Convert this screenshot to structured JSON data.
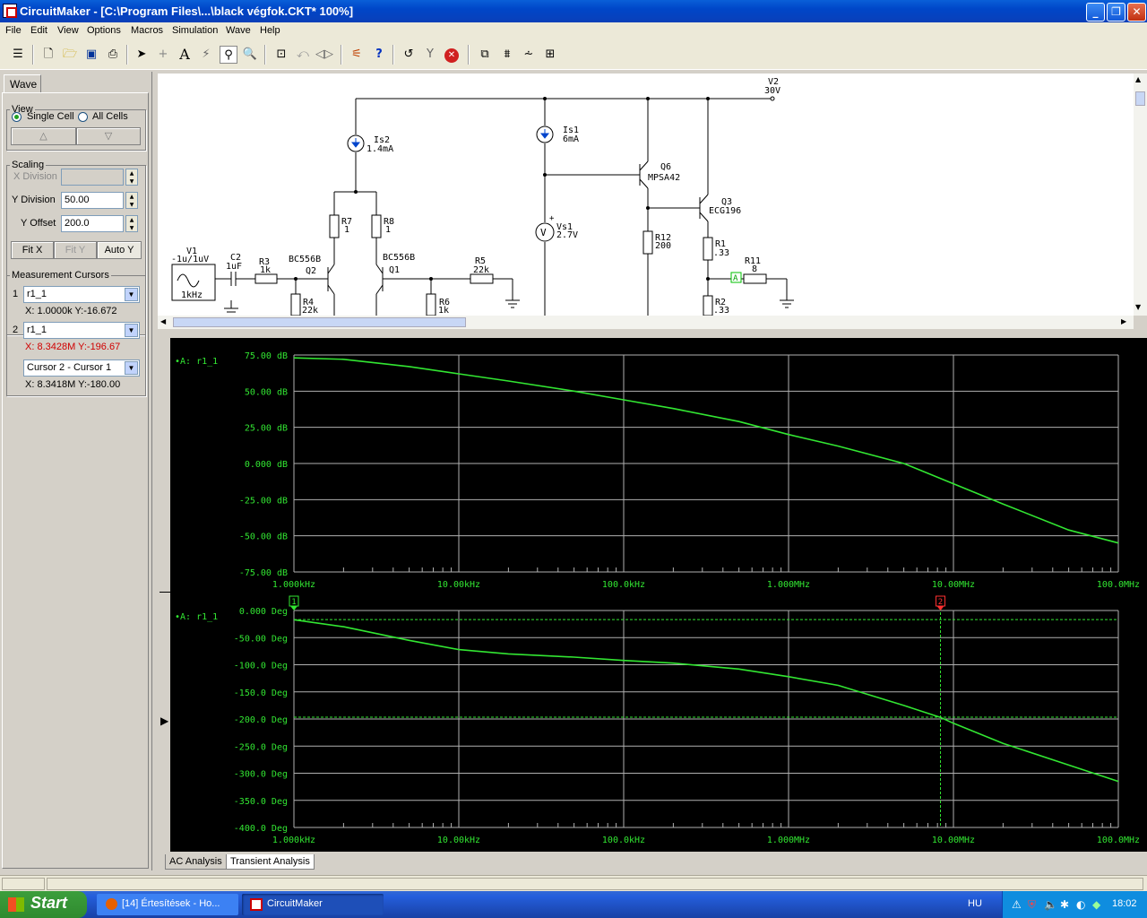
{
  "window": {
    "title": "CircuitMaker - [C:\\Program Files\\...\\black végfok.CKT* 100%]"
  },
  "menu": [
    "File",
    "Edit",
    "View",
    "Options",
    "Macros",
    "Simulation",
    "Wave",
    "Help"
  ],
  "panel": {
    "tab": "Wave",
    "view_label": "View",
    "single_cell": "Single Cell",
    "all_cells": "All Cells",
    "up_arrow": "△",
    "down_arrow": "▽",
    "scaling_label": "Scaling",
    "x_division_label": "X Division",
    "x_division_value": "",
    "y_division_label": "Y Division",
    "y_division_value": "50.00",
    "y_offset_label": "Y Offset",
    "y_offset_value": "200.0",
    "fit_x": "Fit X",
    "fit_y": "Fit Y",
    "auto_y": "Auto Y",
    "cursors_label": "Measurement Cursors",
    "cursor1_num": "1",
    "cursor1_select": "r1_1",
    "cursor1_readout": "X: 1.0000k  Y:-16.672",
    "cursor2_num": "2",
    "cursor2_select": "r1_1",
    "cursor2_readout": "X: 8.3428M  Y:-196.67",
    "diff_select": "Cursor 2 - Cursor 1",
    "diff_readout": "X: 8.3418M  Y:-180.00"
  },
  "schematic": {
    "labels": {
      "v2": "V2",
      "v2val": "30V",
      "is2": "Is2",
      "is2val": "1.4mA",
      "is1": "Is1",
      "is1val": "6mA",
      "q6": "Q6",
      "q6val": "MPSA42",
      "q3": "Q3",
      "q3val": "ECG196",
      "r7": "R7",
      "r7val": "1",
      "r8": "R8",
      "r8val": "1",
      "vs1": "Vs1",
      "vs1val": "2.7V",
      "r12": "R12",
      "r12val": "200",
      "r1": "R1",
      "r1val": ".33",
      "v1": "V1",
      "v1val": "-1u/1uV",
      "v1freq": "1kHz",
      "c2": "C2",
      "c2val": "1uF",
      "r3": "R3",
      "r3val": "1k",
      "q2type": "BC556B",
      "q2": "Q2",
      "q1type": "BC556B",
      "q1": "Q1",
      "r5": "R5",
      "r5val": "22k",
      "r11": "R11",
      "r11val": "8",
      "probe": "A",
      "r4": "R4",
      "r4val": "22k",
      "r6": "R6",
      "r6val": "1k",
      "r2": "R2",
      "r2val": ".33"
    }
  },
  "wave_tabs": [
    "AC Analysis",
    "Transient Analysis"
  ],
  "taskbar": {
    "start": "Start",
    "tasks": [
      "[14] Értesítések - Ho...",
      "CircuitMaker"
    ],
    "lang": "HU",
    "clock": "18:02"
  },
  "colors": {
    "trace": "#32e632",
    "grid": "#b0b0b0",
    "cursor2": "#ff3030",
    "axis_text": "#32e632"
  },
  "chart_data": [
    {
      "type": "line",
      "title": "",
      "series": [
        {
          "name": "A: r1_1",
          "x": [
            1000,
            2000,
            5000,
            10000,
            20000,
            50000,
            100000,
            200000,
            500000,
            1000000,
            2000000,
            5000000,
            10000000,
            20000000,
            50000000,
            100000000
          ],
          "y": [
            73,
            72,
            67,
            62,
            57,
            50,
            44,
            38,
            29,
            20,
            12,
            0,
            -14,
            -28,
            -46,
            -55
          ]
        }
      ],
      "xscale": "log",
      "xlim": [
        1000,
        100000000
      ],
      "ylim": [
        -75,
        75
      ],
      "xticks": [
        "1.000kHz",
        "10.00kHz",
        "100.0kHz",
        "1.000MHz",
        "10.00MHz",
        "100.0MHz"
      ],
      "yticks": [
        "75.00 dB",
        "50.00 dB",
        "25.00 dB",
        "0.000 dB",
        "-25.00 dB",
        "-50.00 dB",
        "-75.00 dB"
      ],
      "grid": true
    },
    {
      "type": "line",
      "title": "",
      "series": [
        {
          "name": "A: r1_1",
          "x": [
            1000,
            2000,
            5000,
            10000,
            20000,
            50000,
            100000,
            200000,
            500000,
            1000000,
            2000000,
            5000000,
            8342800,
            10000000,
            20000000,
            50000000,
            100000000
          ],
          "y": [
            -17,
            -30,
            -55,
            -72,
            -80,
            -86,
            -92,
            -97,
            -108,
            -122,
            -138,
            -175,
            -197,
            -208,
            -245,
            -285,
            -315
          ]
        }
      ],
      "xscale": "log",
      "xlim": [
        1000,
        100000000
      ],
      "ylim": [
        -400,
        0
      ],
      "xticks": [
        "1.000kHz",
        "10.00kHz",
        "100.0kHz",
        "1.000MHz",
        "10.00MHz",
        "100.0MHz"
      ],
      "yticks": [
        "0.000 Deg",
        "-50.00 Deg",
        "-100.0 Deg",
        "-150.0 Deg",
        "-200.0 Deg",
        "-250.0 Deg",
        "-300.0 Deg",
        "-350.0 Deg",
        "-400.0 Deg"
      ],
      "grid": true,
      "cursors": [
        {
          "label": "1",
          "x": 1000,
          "y": -16.672
        },
        {
          "label": "2",
          "x": 8342800,
          "y": -196.67
        }
      ]
    }
  ]
}
